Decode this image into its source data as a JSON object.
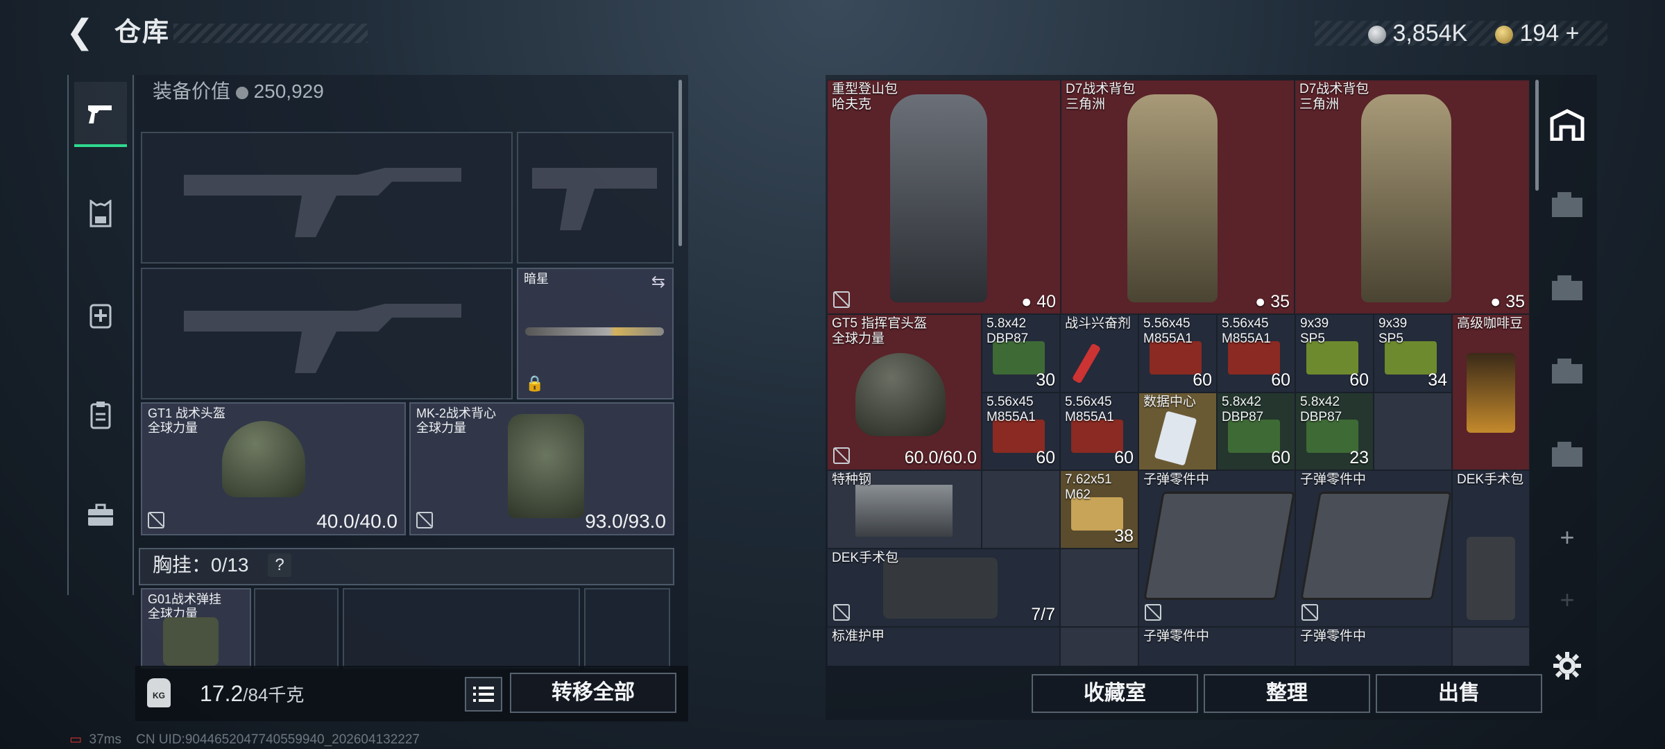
{
  "header": {
    "title": "仓库",
    "back_icon": "back-arrow-icon"
  },
  "currency": {
    "silver": "3,854K",
    "gold": "194",
    "add_label": "+"
  },
  "left": {
    "equip_value_label": "装备价值",
    "equip_value": "250,929",
    "slots": {
      "melee_name": "暗星",
      "helmet_name": "GT1 战术头盔\n全球力量",
      "helmet_durability": "40.0/40.0",
      "armor_name": "MK-2战术背心\n全球力量",
      "armor_durability": "93.0/93.0",
      "rig_name": "G01战术弹挂\n全球力量"
    },
    "chest_label": "胸挂：0/13",
    "chest_help": "?",
    "kg_label": "KG",
    "weight_current": "17.2",
    "weight_max": "/84千克",
    "transfer_all": "转移全部"
  },
  "grid": {
    "backpack1_name": "重型登山包\n哈夫克",
    "backpack1_count": "40",
    "backpack2_name": "D7战术背包\n三角洲",
    "backpack2_count": "35",
    "backpack3_name": "D7战术背包\n三角洲",
    "backpack3_count": "35",
    "helmet_name": "GT5 指挥官头盔\n全球力量",
    "helmet_durability": "60.0/60.0",
    "ammo1_name": "5.8x42\nDBP87",
    "ammo1_count": "30",
    "stim_name": "战斗兴奋剂",
    "ammo2_name": "5.56x45\nM855A1",
    "ammo2_count": "60",
    "ammo3_name": "5.56x45\nM855A1",
    "ammo3_count": "60",
    "ammo4_name": "9x39\nSP5",
    "ammo4_count": "60",
    "ammo5_name": "9x39\nSP5",
    "ammo5_count": "34",
    "coffee_name": "高级咖啡豆",
    "ammo6_name": "5.56x45\nM855A1",
    "ammo6_count": "60",
    "ammo7_name": "5.56x45\nM855A1",
    "ammo7_count": "60",
    "data_name": "数据中心",
    "ammo8_name": "5.8x42\nDBP87",
    "ammo8_count": "60",
    "ammo9_name": "5.8x42\nDBP87",
    "ammo9_count": "23",
    "steel_name": "特种钢",
    "ammo10_name": "7.62x51\nM62",
    "ammo10_count": "38",
    "parts1_name": "子弹零件中",
    "parts2_name": "子弹零件中",
    "dek_name": "DEK手术包",
    "dek_count": "7/7",
    "dek2_name": "DEK手术包",
    "armor_name": "标准护甲",
    "parts3_name": "子弹零件中",
    "parts4_name": "子弹零件中"
  },
  "bottom_buttons": {
    "collection": "收藏室",
    "sort": "整理",
    "sell": "出售"
  },
  "status": {
    "ping": "37ms",
    "uid": "CN UID:9044652047740559940_202604132227"
  }
}
